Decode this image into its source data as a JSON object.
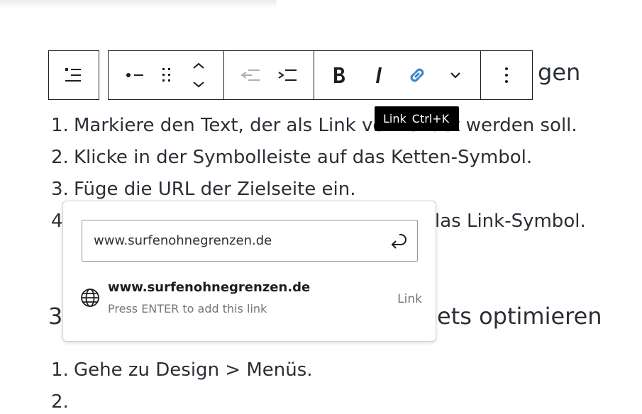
{
  "content": {
    "heading_1_visible_end": "gen",
    "list_1": [
      {
        "num": "1.",
        "text": "Markiere den Text, der als Link verwendet werden soll."
      },
      {
        "num": "2.",
        "text": "Klicke in der Symbolleiste auf das Ketten-Symbol."
      },
      {
        "num": "3.",
        "text": "Füge die URL der Zielseite ein."
      },
      {
        "num": "4",
        "text": "las Link-Symbol."
      }
    ],
    "heading_2_start": "3",
    "heading_2_end": "ets optimieren",
    "list_2": [
      {
        "num": "1.",
        "text": "Gehe zu Design > Menüs."
      }
    ]
  },
  "toolbar": {
    "buttons": [
      {
        "name": "block-type",
        "icon": "list-icon"
      },
      {
        "name": "list-bullet",
        "icon": "bullet-icon"
      },
      {
        "name": "drag-handle",
        "icon": "drag-handle-icon"
      },
      {
        "name": "move",
        "icon": "chevron-up-down-icon"
      },
      {
        "name": "outdent",
        "icon": "outdent-icon"
      },
      {
        "name": "indent",
        "icon": "indent-icon"
      },
      {
        "name": "bold",
        "icon": "bold-icon"
      },
      {
        "name": "italic",
        "icon": "italic-icon"
      },
      {
        "name": "link",
        "icon": "link-icon"
      },
      {
        "name": "more-formats",
        "icon": "chevron-down-icon"
      },
      {
        "name": "options",
        "icon": "more-vertical-icon"
      }
    ],
    "accent_color": "#3582c4"
  },
  "tooltip": {
    "label": "Link",
    "shortcut": "Ctrl+K"
  },
  "link_popover": {
    "url_value": "www.surfenohnegrenzen.de",
    "submit_icon": "enter-icon",
    "suggestion": {
      "title": "www.surfenohnegrenzen.de",
      "hint": "Press ENTER to add this link",
      "type": "Link",
      "icon": "globe-icon"
    }
  }
}
